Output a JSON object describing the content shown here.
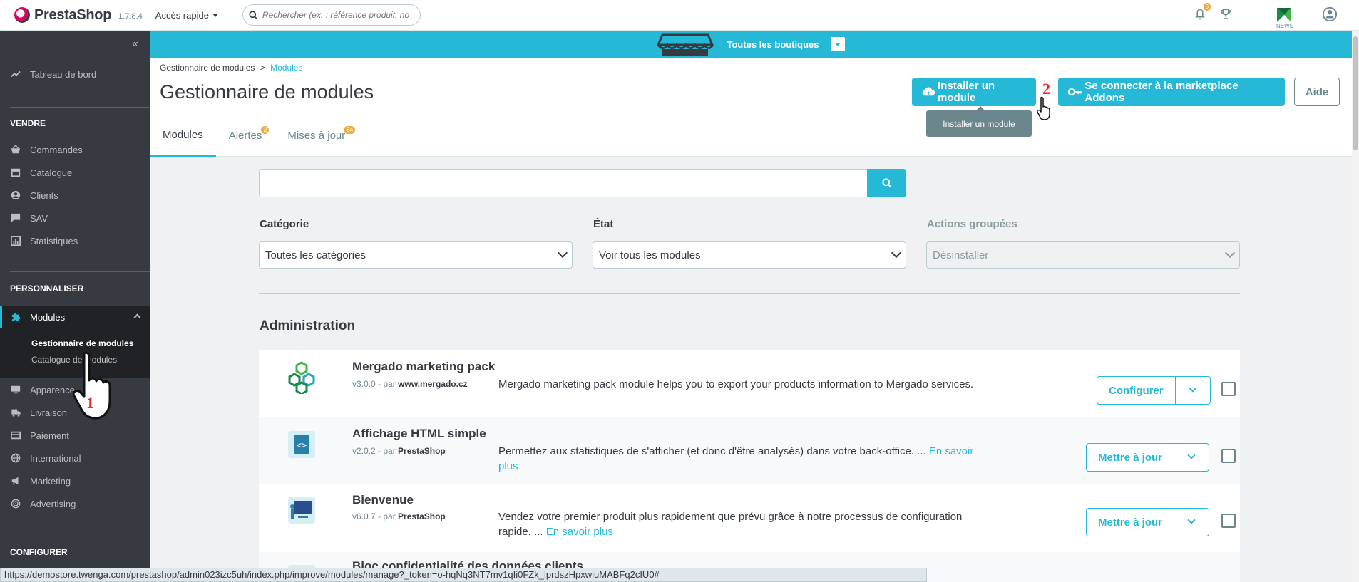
{
  "header": {
    "brand": "PrestaShop",
    "version": "1.7.8.4",
    "quick_access": "Accès rapide",
    "search_placeholder": "Rechercher (ex. : référence produit, no",
    "notifications_count": "6",
    "mergado_label": "NEWS"
  },
  "sidebar": {
    "dashboard": "Tableau de bord",
    "sections": {
      "sell": "VENDRE",
      "customize": "PERSONNALISER",
      "configure": "CONFIGURER"
    },
    "sell_items": [
      "Commandes",
      "Catalogue",
      "Clients",
      "SAV",
      "Statistiques"
    ],
    "modules": "Modules",
    "modules_sub": [
      "Gestionnaire de modules",
      "Catalogue de modules"
    ],
    "customize_items": [
      "Apparence",
      "Livraison",
      "Paiement",
      "International",
      "Marketing",
      "Advertising"
    ]
  },
  "store_bar": {
    "label": "Toutes les boutiques"
  },
  "page": {
    "breadcrumb_parent": "Gestionnaire de modules",
    "breadcrumb_sep": ">",
    "breadcrumb_current": "Modules",
    "title": "Gestionnaire de modules",
    "install_button": "Installer un module",
    "addons_button": "Se connecter à la marketplace Addons",
    "help_button": "Aide",
    "tooltip": "Installer un module",
    "step_1": "1",
    "step_2": "2"
  },
  "tabs": [
    {
      "label": "Modules",
      "badge": ""
    },
    {
      "label": "Alertes",
      "badge": "2"
    },
    {
      "label": "Mises à jour",
      "badge": "54"
    }
  ],
  "filters": {
    "category_label": "Catégorie",
    "category_value": "Toutes les catégories",
    "state_label": "État",
    "state_value": "Voir tous les modules",
    "bulk_label": "Actions groupées",
    "bulk_value": "Désinstaller"
  },
  "category_title": "Administration",
  "modules": [
    {
      "name": "Mergado marketing pack",
      "version": "v3.0.0 - par",
      "author": "www.mergado.cz",
      "description": "Mergado marketing pack module helps you to export your products information to Mergado services.",
      "more": "",
      "action": "Configurer"
    },
    {
      "name": "Affichage HTML simple",
      "version": "v2.0.2 - par",
      "author": "PrestaShop",
      "description": "Permettez aux statistiques de s'afficher (et donc d'être analysés) dans votre back-office. ...",
      "more": "En savoir plus",
      "action": "Mettre à jour"
    },
    {
      "name": "Bienvenue",
      "version": "v6.0.7 - par",
      "author": "PrestaShop",
      "description": "Vendez votre premier produit plus rapidement que prévu grâce à notre processus de configuration rapide. ...",
      "more": "En savoir plus",
      "action": "Mettre à jour"
    },
    {
      "name": "Bloc confidentialité des données clients",
      "version": "",
      "author": "",
      "description": "",
      "more": "",
      "action": ""
    }
  ],
  "status_url": "https://demostore.twenga.com/prestashop/admin023izc5uh/index.php/improve/modules/manage?_token=o-hqNq3NT7mv1qIi0FZk_lprdszHpxwiuMABFq2cIU0#",
  "colors": {
    "primary": "#25b9d7",
    "sidebar": "#363a41",
    "badge": "#f0a93d"
  }
}
